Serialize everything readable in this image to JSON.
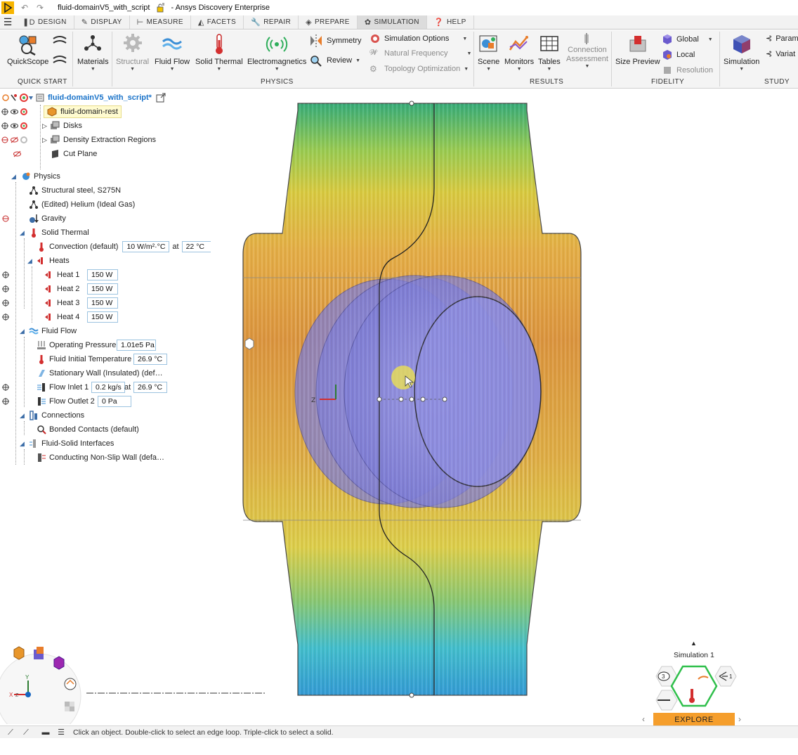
{
  "titlebar": {
    "document": "fluid-domainV5_with_script",
    "app": "- Ansys Discovery Enterprise"
  },
  "tabs": [
    {
      "label": "Design",
      "icon": "design-icon"
    },
    {
      "label": "Display",
      "icon": "display-icon"
    },
    {
      "label": "Measure",
      "icon": "measure-icon"
    },
    {
      "label": "Facets",
      "icon": "facets-icon"
    },
    {
      "label": "Repair",
      "icon": "repair-icon"
    },
    {
      "label": "Prepare",
      "icon": "prepare-icon"
    },
    {
      "label": "Simulation",
      "icon": "simulation-icon",
      "active": true
    },
    {
      "label": "Help",
      "icon": "help-icon"
    }
  ],
  "ribbon": {
    "quickscope": "QuickScope",
    "materials": "Materials",
    "structural": "Structural",
    "fluid_flow": "Fluid Flow",
    "solid_thermal": "Solid Thermal",
    "electromagnetics": "Electromagnetics",
    "symmetry": "Symmetry",
    "review": "Review",
    "simulation_options": "Simulation Options",
    "natural_frequency": "Natural Frequency",
    "topology_optimization": "Topology Optimization",
    "scene": "Scene",
    "monitors": "Monitors",
    "tables": "Tables",
    "connection_assessment_1": "Connection",
    "connection_assessment_2": "Assessment",
    "size_preview": "Size Preview",
    "global": "Global",
    "local": "Local",
    "resolution": "Resolution",
    "simulation": "Simulation",
    "param": "Param",
    "variat": "Variat",
    "groups": {
      "quick_start": "Quick Start",
      "physics": "Physics",
      "results": "Results",
      "fidelity": "Fidelity",
      "study": "Study"
    }
  },
  "tree": {
    "root": "fluid-domainV5_with_script*",
    "items": {
      "fluid_domain_rest": "fluid-domain-rest",
      "disks": "Disks",
      "density_regions": "Density Extraction Regions",
      "cut_plane": "Cut Plane",
      "physics": "Physics",
      "structural_steel": "Structural steel, S275N",
      "helium": "(Edited) Helium (Ideal Gas)",
      "gravity": "Gravity",
      "solid_thermal": "Solid Thermal",
      "convection": "Convection (default)",
      "convection_value": "10 W/m²·°C",
      "at1": "at",
      "convection_temp": "22 °C",
      "heats": "Heats",
      "heat1": "Heat 1",
      "heat1_value": "150 W",
      "heat2": "Heat 2",
      "heat2_value": "150 W",
      "heat3": "Heat 3",
      "heat3_value": "150 W",
      "heat4": "Heat 4",
      "heat4_value": "150 W",
      "fluid_flow": "Fluid Flow",
      "operating_pressure": "Operating Pressure",
      "operating_pressure_value": "1.01e5 Pa",
      "fluid_initial_temp": "Fluid Initial Temperature",
      "fluid_initial_temp_value": "26.9 °C",
      "stationary_wall": "Stationary Wall (Insulated) (def…",
      "flow_inlet": "Flow Inlet 1",
      "flow_inlet_value": "0.2 kg/s",
      "at2": "at",
      "flow_inlet_temp": "26.9 °C",
      "flow_outlet": "Flow Outlet 2",
      "flow_outlet_value": "0 Pa",
      "connections": "Connections",
      "bonded_contacts": "Bonded Contacts (default)",
      "fluid_solid": "Fluid-Solid Interfaces",
      "conducting_wall": "Conducting Non-Slip Wall (defa…"
    }
  },
  "triad": {
    "x": "X",
    "y": "Y",
    "z": "Z"
  },
  "simnav": {
    "title": "Simulation 1",
    "badge_left": "3",
    "badge_right": "1",
    "explore": "Explore"
  },
  "status": "Click an object. Double-click to select an edge loop. Triple-click to select a solid.",
  "colors": {
    "accent_orange": "#f59e2c",
    "active_hex_green": "#2fbf4b",
    "selection_yellow": "#fffbd0",
    "link_blue": "#1a73c9"
  }
}
